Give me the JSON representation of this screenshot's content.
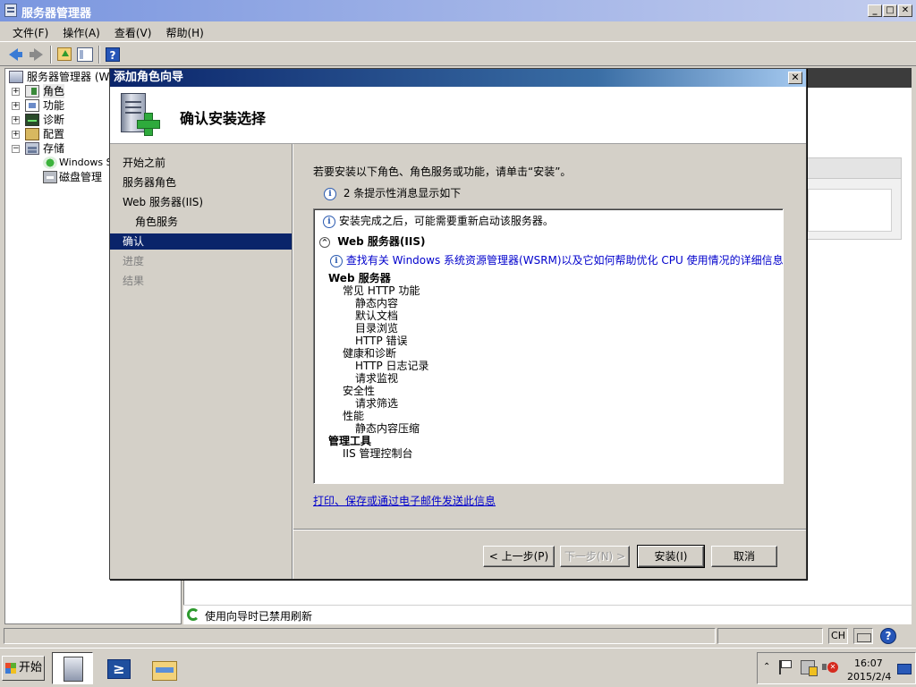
{
  "main_window": {
    "title": "服务器管理器",
    "buttons": {
      "minimize": "_",
      "maximize": "□",
      "close": "✕"
    }
  },
  "menu": [
    "文件(F)",
    "操作(A)",
    "查看(V)",
    "帮助(H)"
  ],
  "toolbar": {
    "help_glyph": "?"
  },
  "tree": {
    "root": "服务器管理器 (WI",
    "items": [
      {
        "label": "角色",
        "expander": "+"
      },
      {
        "label": "功能",
        "expander": "+"
      },
      {
        "label": "诊断",
        "expander": "+"
      },
      {
        "label": "配置",
        "expander": "+"
      },
      {
        "label": "存储",
        "expander": "−"
      }
    ],
    "storage_children": [
      "Windows S",
      "磁盘管理"
    ]
  },
  "status": {
    "refresh_text": "使用向导时已禁用刷新"
  },
  "statusbar": {
    "lang": "CH",
    "help": "?"
  },
  "taskbar": {
    "start_label": "开始",
    "powershell_glyph": "≥",
    "clock_time": "16:07",
    "clock_date": "2015/2/4",
    "tray_up": "⌃"
  },
  "wizard": {
    "title": "添加角色向导",
    "close": "✕",
    "header_title": "确认安装选择",
    "nav": [
      {
        "label": "开始之前",
        "state": "normal"
      },
      {
        "label": "服务器角色",
        "state": "normal"
      },
      {
        "label": "Web 服务器(IIS)",
        "state": "normal"
      },
      {
        "label": "角色服务",
        "state": "sub"
      },
      {
        "label": "确认",
        "state": "active"
      },
      {
        "label": "进度",
        "state": "disabled"
      },
      {
        "label": "结果",
        "state": "disabled"
      }
    ],
    "instruction": "若要安装以下角色、角色服务或功能，请单击“安装”。",
    "info_glyph": "i",
    "warning_summary": "2 条提示性消息显示如下",
    "summary": {
      "restart_note": "安装完成之后，可能需要重新启动该服务器。",
      "section_title": "Web 服务器(IIS)",
      "collapse_glyph": "^",
      "info_link": "查找有关 Windows 系统资源管理器(WSRM)以及它如何帮助优化 CPU 使用情况的详细信息",
      "items": [
        {
          "text": "Web 服务器",
          "level": 0,
          "bold": true
        },
        {
          "text": "常见 HTTP 功能",
          "level": 1
        },
        {
          "text": "静态内容",
          "level": 2
        },
        {
          "text": "默认文档",
          "level": 2
        },
        {
          "text": "目录浏览",
          "level": 2
        },
        {
          "text": "HTTP 错误",
          "level": 2
        },
        {
          "text": "健康和诊断",
          "level": 1
        },
        {
          "text": "HTTP 日志记录",
          "level": 2
        },
        {
          "text": "请求监视",
          "level": 2
        },
        {
          "text": "安全性",
          "level": 1
        },
        {
          "text": "请求筛选",
          "level": 2
        },
        {
          "text": "性能",
          "level": 1
        },
        {
          "text": "静态内容压缩",
          "level": 2
        },
        {
          "text": "管理工具",
          "level": 0,
          "bold": true
        },
        {
          "text": "IIS 管理控制台",
          "level": 1
        }
      ]
    },
    "print_link": "打印、保存或通过电子邮件发送此信息",
    "buttons": {
      "back": "< 上一步(P)",
      "next": "下一步(N) >",
      "install": "安装(I)",
      "cancel": "取消"
    }
  }
}
